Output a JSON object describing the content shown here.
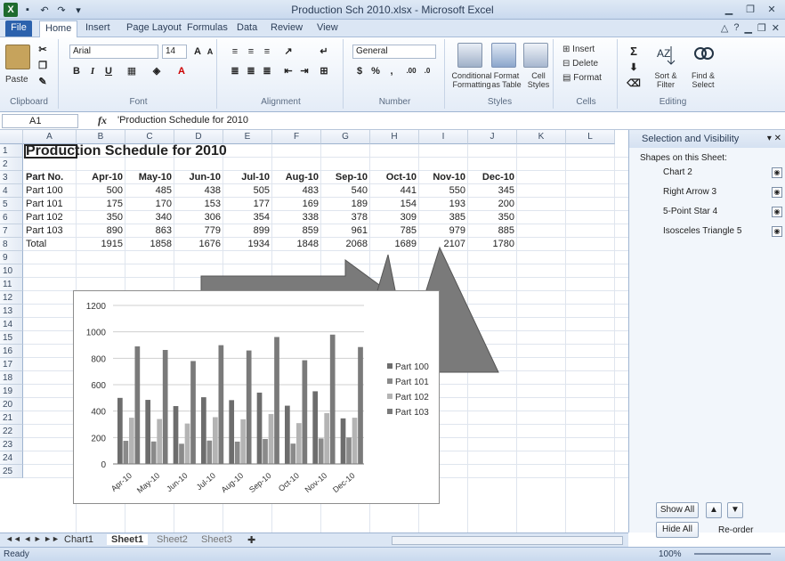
{
  "window": {
    "title": "Production Sch 2010.xlsx - Microsoft Excel"
  },
  "tabs": [
    "File",
    "Home",
    "Insert",
    "Page Layout",
    "Formulas",
    "Data",
    "Review",
    "View"
  ],
  "ribbon": {
    "clipboard": {
      "paste": "Paste",
      "label": "Clipboard"
    },
    "font": {
      "name": "Arial",
      "size": "14",
      "label": "Font",
      "bold": "B",
      "italic": "I",
      "underline": "U"
    },
    "alignment": {
      "label": "Alignment"
    },
    "number": {
      "format": "General",
      "currency": "$",
      "percent": "%",
      "comma": ",",
      "label": "Number"
    },
    "styles": {
      "conditional": "Conditional Formatting",
      "format_table": "Format as Table",
      "cell_styles": "Cell Styles",
      "label": "Styles"
    },
    "cells": {
      "insert": "Insert",
      "delete": "Delete",
      "format": "Format",
      "label": "Cells"
    },
    "editing": {
      "sum": "Σ",
      "sort": "Sort & Filter",
      "find": "Find & Select",
      "label": "Editing"
    }
  },
  "formula_bar": {
    "cell": "A1",
    "fx": "fx",
    "formula": "'Production Schedule for 2010"
  },
  "columns": [
    "A",
    "B",
    "C",
    "D",
    "E",
    "F",
    "G",
    "H",
    "I",
    "J",
    "K",
    "L"
  ],
  "rows": [
    "1",
    "2",
    "3",
    "4",
    "5",
    "6",
    "7",
    "8",
    "9",
    "10",
    "11",
    "12",
    "13",
    "14",
    "15",
    "16",
    "17",
    "18",
    "19",
    "20",
    "21",
    "22",
    "23",
    "24",
    "25"
  ],
  "sheet": {
    "title": "Production Schedule for 2010",
    "header": [
      "Part No.",
      "Apr-10",
      "May-10",
      "Jun-10",
      "Jul-10",
      "Aug-10",
      "Sep-10",
      "Oct-10",
      "Nov-10",
      "Dec-10"
    ],
    "data": [
      [
        "Part 100",
        "500",
        "485",
        "438",
        "505",
        "483",
        "540",
        "441",
        "550",
        "345"
      ],
      [
        "Part 101",
        "175",
        "170",
        "153",
        "177",
        "169",
        "189",
        "154",
        "193",
        "200"
      ],
      [
        "Part 102",
        "350",
        "340",
        "306",
        "354",
        "338",
        "378",
        "309",
        "385",
        "350"
      ],
      [
        "Part 103",
        "890",
        "863",
        "779",
        "899",
        "859",
        "961",
        "785",
        "979",
        "885"
      ],
      [
        "Total",
        "1915",
        "1858",
        "1676",
        "1934",
        "1848",
        "2068",
        "1689",
        "2107",
        "1780"
      ]
    ]
  },
  "chart_data": {
    "type": "bar",
    "categories": [
      "Apr-10",
      "May-10",
      "Jun-10",
      "Jul-10",
      "Aug-10",
      "Sep-10",
      "Oct-10",
      "Nov-10",
      "Dec-10"
    ],
    "series": [
      {
        "name": "Part 100",
        "values": [
          500,
          485,
          438,
          505,
          483,
          540,
          441,
          550,
          345
        ]
      },
      {
        "name": "Part 101",
        "values": [
          175,
          170,
          153,
          177,
          169,
          189,
          154,
          193,
          200
        ]
      },
      {
        "name": "Part 102",
        "values": [
          350,
          340,
          306,
          354,
          338,
          378,
          309,
          385,
          350
        ]
      },
      {
        "name": "Part 103",
        "values": [
          890,
          863,
          779,
          899,
          859,
          961,
          785,
          979,
          885
        ]
      }
    ],
    "yticks": [
      "0",
      "200",
      "400",
      "600",
      "800",
      "1000",
      "1200"
    ],
    "ylim": [
      0,
      1200
    ],
    "colors": [
      "#6d6d6d",
      "#8a8a8a",
      "#b4b4b4",
      "#7a7a7a"
    ],
    "legend": "right"
  },
  "pane": {
    "title": "Selection and Visibility",
    "subtitle": "Shapes on this Sheet:",
    "shapes": [
      "Chart 2",
      "Right Arrow 3",
      "5-Point Star 4",
      "Isosceles Triangle 5"
    ],
    "show_all": "Show All",
    "hide_all": "Hide All",
    "reorder": "Re-order"
  },
  "sheet_tabs": [
    "Chart1",
    "Sheet1",
    "Sheet2",
    "Sheet3"
  ],
  "status": {
    "ready": "Ready",
    "zoom": "100%"
  }
}
